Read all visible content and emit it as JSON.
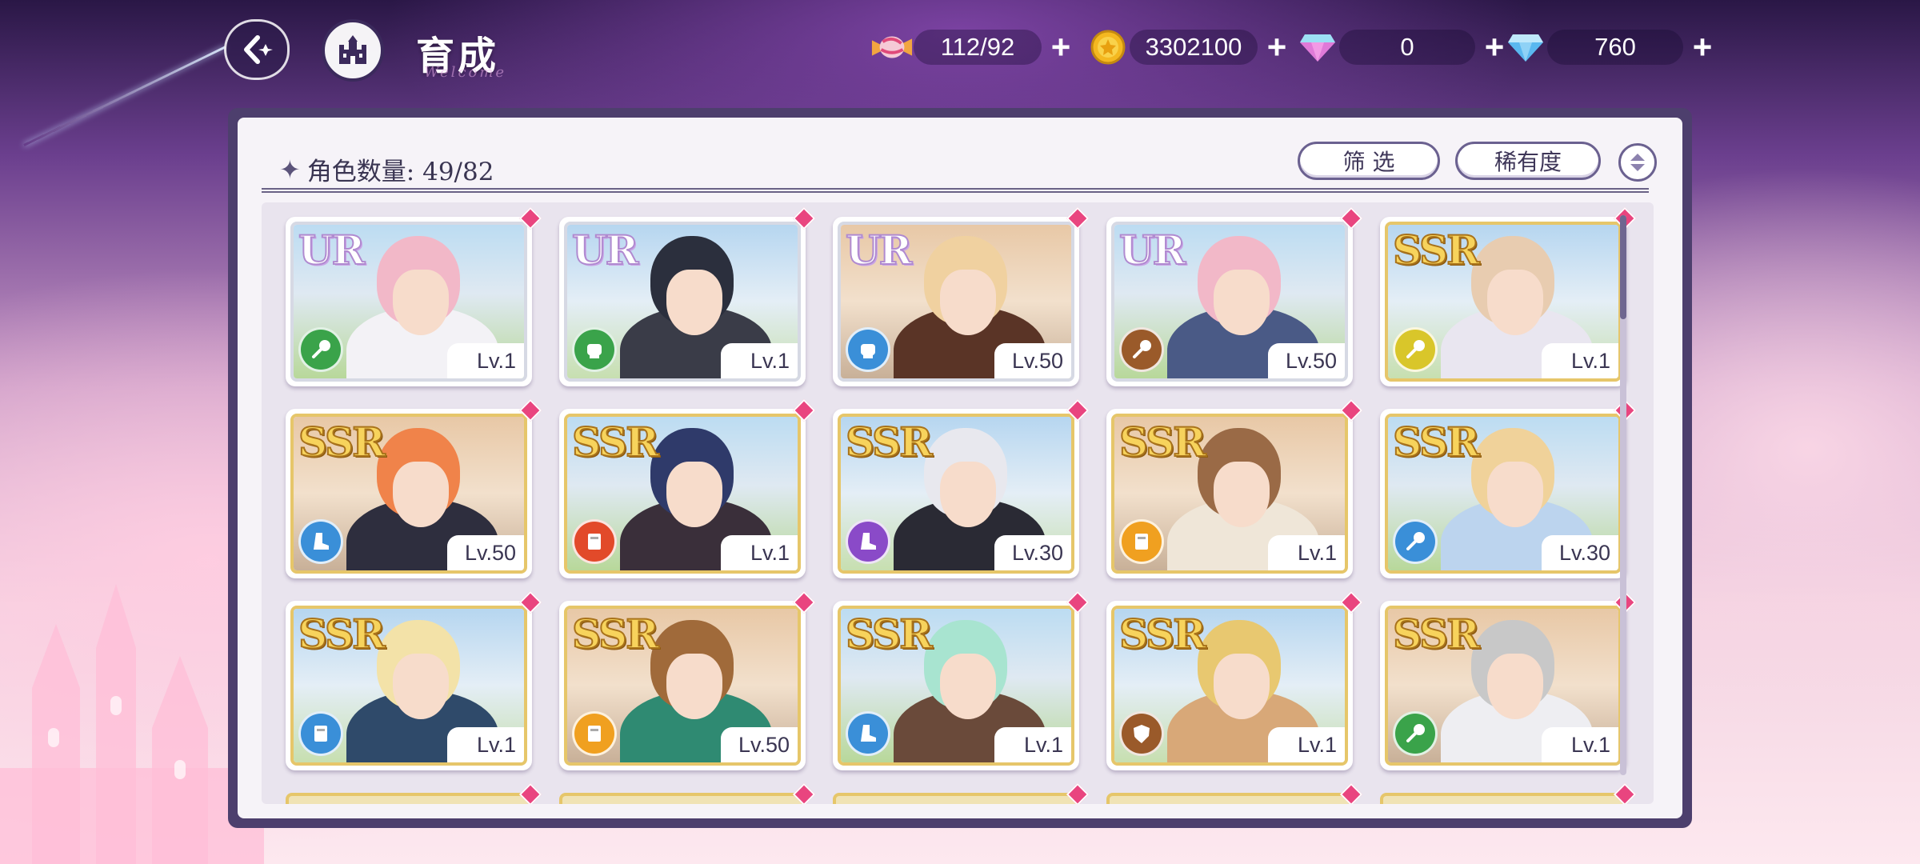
{
  "header": {
    "title": "育成",
    "title_deco": "Welcome"
  },
  "resources": [
    {
      "name": "candy",
      "value": "112/92"
    },
    {
      "name": "gold-coin",
      "value": "3302100"
    },
    {
      "name": "pink-diamond",
      "value": "0"
    },
    {
      "name": "blue-diamond",
      "value": "760"
    }
  ],
  "panel": {
    "count_label": "角色数量: 49/82",
    "filter_label": "筛 选",
    "sort_label": "稀有度"
  },
  "cards": [
    {
      "rarity": "UR",
      "level": "Lv.1",
      "attr": "lance",
      "hair": "#f2b8c8",
      "outfit": "#f3f2f6",
      "attr_color": "#3aa34a"
    },
    {
      "rarity": "UR",
      "level": "Lv.1",
      "attr": "fist",
      "hair": "#2b2f3d",
      "outfit": "#3a3c48",
      "attr_color": "#3aa34a"
    },
    {
      "rarity": "UR",
      "level": "Lv.50",
      "attr": "fist",
      "hair": "#f0d1a0",
      "outfit": "#5a3426",
      "attr_color": "#3a8fd8"
    },
    {
      "rarity": "UR",
      "level": "Lv.50",
      "attr": "lance",
      "hair": "#f2b8c8",
      "outfit": "#4a5a86",
      "attr_color": "#9a5a2a"
    },
    {
      "rarity": "SSR",
      "level": "Lv.1",
      "attr": "lance",
      "hair": "#e8ccb0",
      "outfit": "#e9e6f0",
      "attr_color": "#d9c62a"
    },
    {
      "rarity": "SSR",
      "level": "Lv.50",
      "attr": "boot",
      "hair": "#f0834a",
      "outfit": "#2e2e3e",
      "attr_color": "#3a8fd8"
    },
    {
      "rarity": "SSR",
      "level": "Lv.1",
      "attr": "book",
      "hair": "#2f3a6a",
      "outfit": "#3a2f3a",
      "attr_color": "#e24a2a"
    },
    {
      "rarity": "SSR",
      "level": "Lv.30",
      "attr": "boot",
      "hair": "#e8e8ee",
      "outfit": "#2a2a34",
      "attr_color": "#8a4ac8"
    },
    {
      "rarity": "SSR",
      "level": "Lv.1",
      "attr": "book",
      "hair": "#9a6a46",
      "outfit": "#efe6d8",
      "attr_color": "#f0a020"
    },
    {
      "rarity": "SSR",
      "level": "Lv.30",
      "attr": "lance",
      "hair": "#f0d29a",
      "outfit": "#bcd4ee",
      "attr_color": "#3a8fd8"
    },
    {
      "rarity": "SSR",
      "level": "Lv.1",
      "attr": "book",
      "hair": "#f3e2a8",
      "outfit": "#2f4a6a",
      "attr_color": "#3a8fd8"
    },
    {
      "rarity": "SSR",
      "level": "Lv.50",
      "attr": "book",
      "hair": "#a06a3a",
      "outfit": "#2f8a72",
      "attr_color": "#f0a020"
    },
    {
      "rarity": "SSR",
      "level": "Lv.1",
      "attr": "boot",
      "hair": "#a8e4d0",
      "outfit": "#6a4a3a",
      "attr_color": "#3a8fd8"
    },
    {
      "rarity": "SSR",
      "level": "Lv.1",
      "attr": "shield",
      "hair": "#e8c870",
      "outfit": "#d8a878",
      "attr_color": "#9a5a2a"
    },
    {
      "rarity": "SSR",
      "level": "Lv.1",
      "attr": "lance",
      "hair": "#c8c8c8",
      "outfit": "#eeeef2",
      "attr_color": "#3aa34a"
    }
  ]
}
